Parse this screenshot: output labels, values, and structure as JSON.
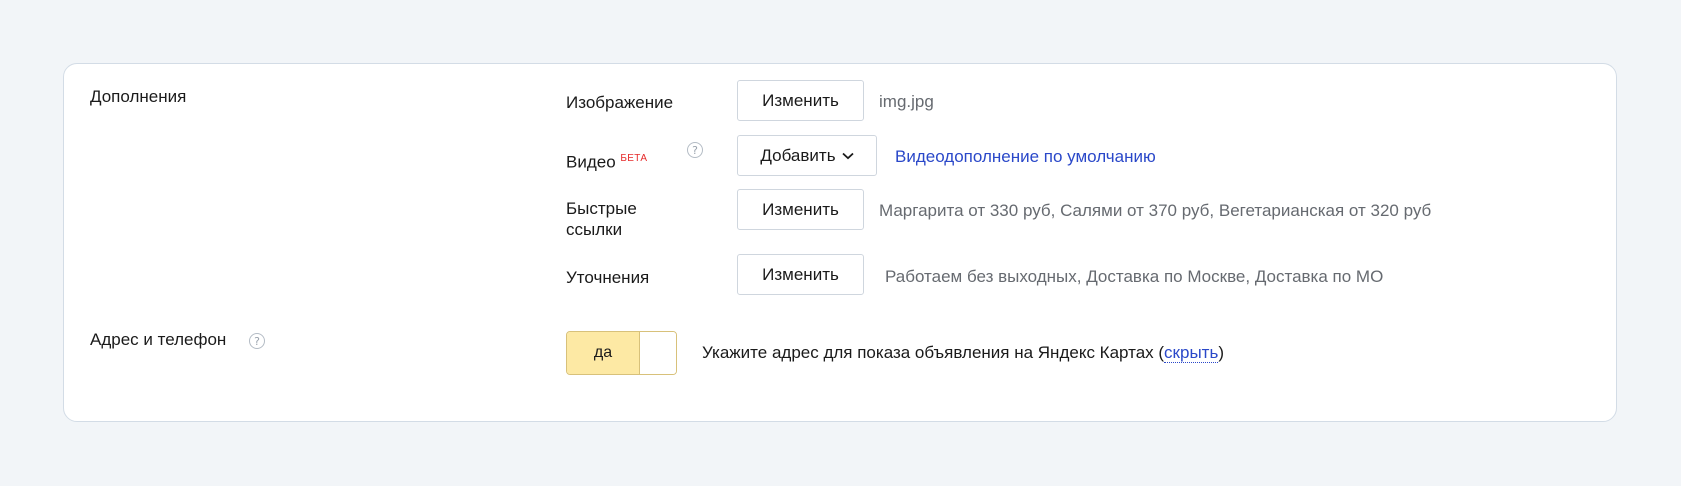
{
  "extras": {
    "section_label": "Дополнения",
    "image": {
      "label": "Изображение",
      "button": "Изменить",
      "value": "img.jpg"
    },
    "video": {
      "label": "Видео",
      "badge": "БЕТА",
      "help": "?",
      "button": "Добавить",
      "link": "Видеодополнение по умолчанию"
    },
    "sitelinks": {
      "label_line1": "Быстрые",
      "label_line2": "ссылки",
      "button": "Изменить",
      "value": "Маргарита от 330 руб, Салями от 370 руб, Вегетарианская от 320 руб"
    },
    "callouts": {
      "label": "Уточнения",
      "button": "Изменить",
      "value": "Работаем без выходных, Доставка по Москве, Доставка по МО"
    }
  },
  "contacts": {
    "section_label": "Адрес и телефон",
    "help": "?",
    "toggle_label": "да",
    "hint_prefix": "Укажите адрес для показа объявления на Яндекс Картах (",
    "hint_link": "скрыть",
    "hint_suffix": ")"
  },
  "colors": {
    "background": "#f2f5f8",
    "link": "#2a48c9",
    "beta": "#e62a2a",
    "toggle_on": "#fde9a4"
  }
}
